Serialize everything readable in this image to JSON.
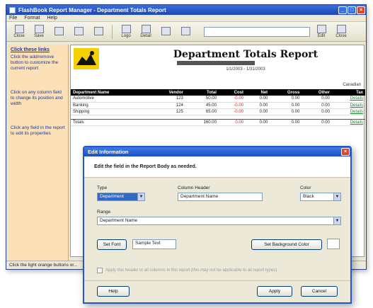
{
  "app": {
    "title": "FlashBook Report Manager - Department Totals Report",
    "menu": [
      "File",
      "Format",
      "Help"
    ],
    "toolbar": [
      "Close",
      "Save",
      "",
      "",
      "",
      "Logo",
      "Detail",
      "",
      "",
      "",
      "",
      "Edit",
      "Close"
    ],
    "status": "Click the light orange buttons or..."
  },
  "help": {
    "title": "Click these links",
    "items": [
      "Click the add/remove button to customize the current report",
      "Click on any column field to change its position and width",
      "Click any field in the report to edit its properties"
    ]
  },
  "report": {
    "title": "Department Totals Report",
    "date_range": "1/1/2003 - 1/31/2003",
    "currency": "Canadian",
    "columns": [
      "Department Name",
      "Vendor",
      "Total",
      "Cost",
      "Net",
      "Gross",
      "Other",
      "Tax"
    ],
    "rows": [
      {
        "name": "Automotive",
        "vendor": "123",
        "total": "50.00",
        "cost": "-0.00",
        "net": "0.00",
        "gross": "0.00",
        "other": "0.00",
        "tax": "Details"
      },
      {
        "name": "Banking",
        "vendor": "124",
        "total": "45.00",
        "cost": "-0.00",
        "net": "0.00",
        "gross": "0.00",
        "other": "0.00",
        "tax": "Details"
      },
      {
        "name": "Shipping",
        "vendor": "125",
        "total": "65.00",
        "cost": "-0.00",
        "net": "0.00",
        "gross": "0.00",
        "other": "0.00",
        "tax": "Details"
      }
    ],
    "totals": {
      "name": "Totals",
      "total": "160.00",
      "cost": "0.00",
      "net": "0.00",
      "gross": "0.00",
      "other": "0.00",
      "tax": "Details"
    }
  },
  "dialog": {
    "title": "Edit Information",
    "heading": "Edit the field in the Report Body as needed.",
    "type_label": "Type",
    "type_value": "Department",
    "column_header_label": "Column Header",
    "column_header_value": "Department Name",
    "color_label": "Color",
    "color_value": "Black",
    "range_label": "Range",
    "range_value": "Department Name",
    "font_button": "Set Font",
    "font_sample": "Sample Text",
    "background_button": "Set Background Color",
    "checkbox_text": "Apply this header to all columns in this report (this may not be applicable to all report types)",
    "help_button": "Help",
    "apply_button": "Apply",
    "cancel_button": "Cancel"
  }
}
